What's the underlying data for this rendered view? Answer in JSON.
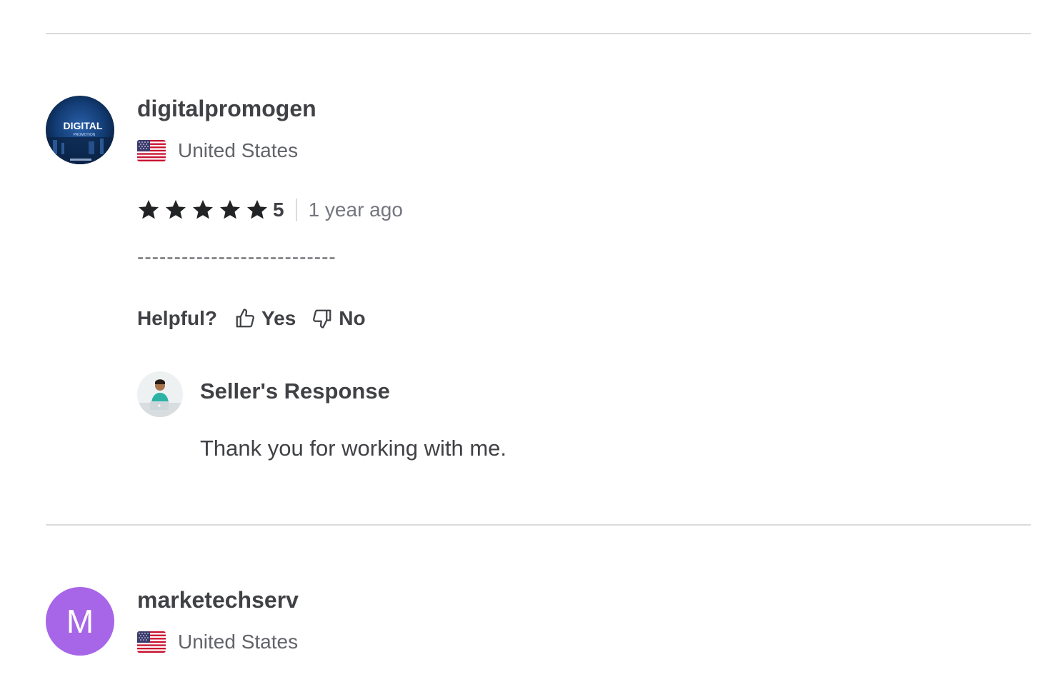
{
  "reviews": [
    {
      "username": "digitalpromogen",
      "avatar": {
        "type": "image",
        "logo_text": "DIGITAL",
        "logo_subtext": "PROMOTION"
      },
      "country": "United States",
      "flag_icon": "us-flag-icon",
      "rating": "5",
      "stars_filled": 5,
      "stars_total": 5,
      "time_ago": "1 year ago",
      "body": "---------------------------",
      "helpful": {
        "label": "Helpful?",
        "yes_label": "Yes",
        "no_label": "No"
      },
      "seller_response": {
        "title": "Seller's Response",
        "text": "Thank you for working with me."
      }
    },
    {
      "username": "marketechserv",
      "avatar": {
        "type": "letter",
        "letter": "M",
        "color": "#a765e8"
      },
      "country": "United States",
      "flag_icon": "us-flag-icon"
    }
  ],
  "colors": {
    "text_primary": "#404145",
    "text_secondary": "#62646a",
    "text_muted": "#74767e",
    "divider": "#dadbdd",
    "avatar_purple": "#a765e8"
  }
}
